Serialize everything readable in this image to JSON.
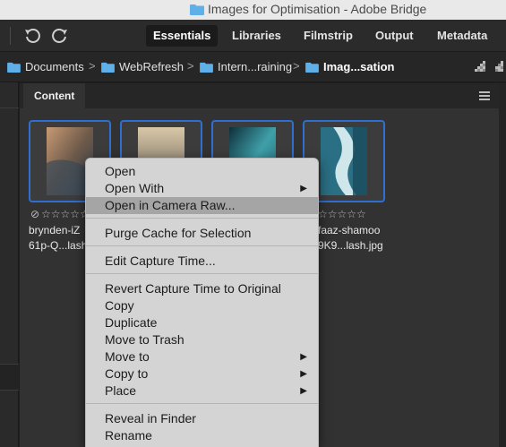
{
  "window": {
    "title": "Images for Optimisation - Adobe Bridge"
  },
  "toolbar": {
    "undo_icon": "rotate-left-icon",
    "redo_icon": "rotate-right-icon",
    "workspaces": [
      "Essentials",
      "Libraries",
      "Filmstrip",
      "Output",
      "Metadata"
    ],
    "active_workspace": "Essentials"
  },
  "path": {
    "crumbs": [
      "Documents",
      "WebRefresh",
      "Intern...raining",
      "Imag...sation"
    ],
    "separator": ">"
  },
  "content_panel": {
    "tab_label": "Content",
    "menu_icon": "hamburger-icon"
  },
  "thumbnails": [
    {
      "line1": "brynden-iZ",
      "line2": "61p-Q...lash",
      "stars": "☆☆☆☆☆",
      "reject": "⊘",
      "colors": [
        "#6e5a4a",
        "#c89a74",
        "#2f3e4e"
      ]
    },
    {
      "line1": "",
      "line2": "",
      "stars": "",
      "reject": "",
      "colors": [
        "#8c8070",
        "#d8c8a8",
        "#3a4450"
      ]
    },
    {
      "line1": "",
      "line2": "",
      "stars": "",
      "reject": "",
      "colors": [
        "#1d5a66",
        "#3fa0aa",
        "#0e2f3a"
      ]
    },
    {
      "line1": "faaz-shamoo",
      "line2": "9K9...lash.jpg",
      "stars": "☆☆☆☆☆",
      "reject": "",
      "colors": [
        "#2a6f84",
        "#cfe6ea",
        "#1a4a5c"
      ]
    }
  ],
  "context_menu": {
    "items": [
      {
        "label": "Open",
        "submenu": false
      },
      {
        "label": "Open With",
        "submenu": true
      },
      {
        "label": "Open in Camera Raw...",
        "submenu": false,
        "highlighted": true
      },
      {
        "label": "Purge Cache for Selection",
        "submenu": false
      },
      {
        "label": "Edit Capture Time...",
        "submenu": false
      },
      {
        "label": "Revert Capture Time to Original",
        "submenu": false
      },
      {
        "label": "Copy",
        "submenu": false
      },
      {
        "label": "Duplicate",
        "submenu": false
      },
      {
        "label": "Move to Trash",
        "submenu": false
      },
      {
        "label": "Move to",
        "submenu": true
      },
      {
        "label": "Copy to",
        "submenu": true
      },
      {
        "label": "Place",
        "submenu": true
      },
      {
        "label": "Reveal in Finder",
        "submenu": false
      },
      {
        "label": "Rename",
        "submenu": false
      }
    ],
    "submenu_arrow": "▶"
  },
  "colors": {
    "accent": "#2f6fd0",
    "folder": "#5fb0e8",
    "menu_bg": "#d4d4d4",
    "menu_highlight": "#a5a5a5"
  }
}
